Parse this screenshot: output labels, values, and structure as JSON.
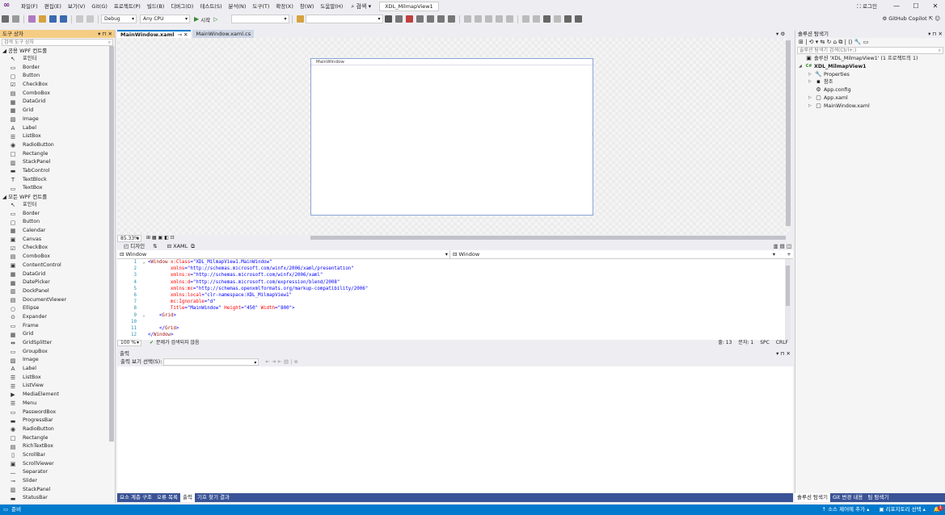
{
  "menu": {
    "items": [
      "파일(F)",
      "편집(E)",
      "보기(V)",
      "Git(G)",
      "프로젝트(P)",
      "빌드(B)",
      "디버그(D)",
      "테스트(S)",
      "분석(N)",
      "도구(T)",
      "확장(X)",
      "창(W)",
      "도움말(H)"
    ],
    "search_label": "검색",
    "project_title": "XDL_MilmapView1",
    "login": "로그인"
  },
  "toolbar": {
    "config": "Debug",
    "platform": "Any CPU",
    "start": "시작",
    "copilot": "GitHub Copilot"
  },
  "toolbox": {
    "title": "도구 상자",
    "search_placeholder": "검색 도구 상자",
    "group1": "공용 WPF 컨트롤",
    "common": [
      {
        "label": "포인터",
        "icon": "pointer-icon",
        "g": "↖"
      },
      {
        "label": "Border",
        "icon": "border-icon",
        "g": "▭"
      },
      {
        "label": "Button",
        "icon": "button-icon",
        "g": "▢"
      },
      {
        "label": "CheckBox",
        "icon": "checkbox-icon",
        "g": "☑"
      },
      {
        "label": "ComboBox",
        "icon": "combobox-icon",
        "g": "▤"
      },
      {
        "label": "DataGrid",
        "icon": "datagrid-icon",
        "g": "▦"
      },
      {
        "label": "Grid",
        "icon": "grid-icon",
        "g": "▦"
      },
      {
        "label": "Image",
        "icon": "image-icon",
        "g": "▨"
      },
      {
        "label": "Label",
        "icon": "label-icon",
        "g": "A"
      },
      {
        "label": "ListBox",
        "icon": "listbox-icon",
        "g": "☰"
      },
      {
        "label": "RadioButton",
        "icon": "radiobutton-icon",
        "g": "◉"
      },
      {
        "label": "Rectangle",
        "icon": "rectangle-icon",
        "g": "□"
      },
      {
        "label": "StackPanel",
        "icon": "stackpanel-icon",
        "g": "▥"
      },
      {
        "label": "TabControl",
        "icon": "tabcontrol-icon",
        "g": "▬"
      },
      {
        "label": "TextBlock",
        "icon": "textblock-icon",
        "g": "T"
      },
      {
        "label": "TextBox",
        "icon": "textbox-icon",
        "g": "▭"
      }
    ],
    "group2": "모든 WPF 컨트롤",
    "all": [
      {
        "label": "포인터",
        "icon": "pointer-icon",
        "g": "↖"
      },
      {
        "label": "Border",
        "icon": "border-icon",
        "g": "▭"
      },
      {
        "label": "Button",
        "icon": "button-icon",
        "g": "▢"
      },
      {
        "label": "Calendar",
        "icon": "calendar-icon",
        "g": "▦"
      },
      {
        "label": "Canvas",
        "icon": "canvas-icon",
        "g": "▣"
      },
      {
        "label": "CheckBox",
        "icon": "checkbox-icon",
        "g": "☑"
      },
      {
        "label": "ComboBox",
        "icon": "combobox-icon",
        "g": "▤"
      },
      {
        "label": "ContentControl",
        "icon": "contentcontrol-icon",
        "g": "▣"
      },
      {
        "label": "DataGrid",
        "icon": "datagrid-icon",
        "g": "▦"
      },
      {
        "label": "DatePicker",
        "icon": "datepicker-icon",
        "g": "▦"
      },
      {
        "label": "DockPanel",
        "icon": "dockpanel-icon",
        "g": "▥"
      },
      {
        "label": "DocumentViewer",
        "icon": "documentviewer-icon",
        "g": "▤"
      },
      {
        "label": "Ellipse",
        "icon": "ellipse-icon",
        "g": "○"
      },
      {
        "label": "Expander",
        "icon": "expander-icon",
        "g": "⊙"
      },
      {
        "label": "Frame",
        "icon": "frame-icon",
        "g": "▭"
      },
      {
        "label": "Grid",
        "icon": "grid-icon",
        "g": "▦"
      },
      {
        "label": "GridSplitter",
        "icon": "gridsplitter-icon",
        "g": "⇹"
      },
      {
        "label": "GroupBox",
        "icon": "groupbox-icon",
        "g": "▭"
      },
      {
        "label": "Image",
        "icon": "image-icon",
        "g": "▨"
      },
      {
        "label": "Label",
        "icon": "label-icon",
        "g": "A"
      },
      {
        "label": "ListBox",
        "icon": "listbox-icon",
        "g": "☰"
      },
      {
        "label": "ListView",
        "icon": "listview-icon",
        "g": "☰"
      },
      {
        "label": "MediaElement",
        "icon": "mediaelement-icon",
        "g": "▶"
      },
      {
        "label": "Menu",
        "icon": "menu-icon",
        "g": "☰"
      },
      {
        "label": "PasswordBox",
        "icon": "passwordbox-icon",
        "g": "▭"
      },
      {
        "label": "ProgressBar",
        "icon": "progressbar-icon",
        "g": "▬"
      },
      {
        "label": "RadioButton",
        "icon": "radiobutton-icon",
        "g": "◉"
      },
      {
        "label": "Rectangle",
        "icon": "rectangle-icon",
        "g": "□"
      },
      {
        "label": "RichTextBox",
        "icon": "richtextbox-icon",
        "g": "▤"
      },
      {
        "label": "ScrollBar",
        "icon": "scrollbar-icon",
        "g": "▯"
      },
      {
        "label": "ScrollViewer",
        "icon": "scrollviewer-icon",
        "g": "▣"
      },
      {
        "label": "Separator",
        "icon": "separator-icon",
        "g": "—"
      },
      {
        "label": "Slider",
        "icon": "slider-icon",
        "g": "⊸"
      },
      {
        "label": "StackPanel",
        "icon": "stackpanel-icon",
        "g": "▥"
      },
      {
        "label": "StatusBar",
        "icon": "statusbar-icon",
        "g": "▬"
      }
    ]
  },
  "editor": {
    "tabs": [
      {
        "label": "MainWindow.xaml",
        "selected": true
      },
      {
        "label": "MainWindow.xaml.cs",
        "selected": false
      }
    ],
    "designer_window_title": "MainWindow",
    "zoom": "85.33%",
    "design_tab": "디자인",
    "xaml_tab": "XAML",
    "left_selector": "Window",
    "right_selector": "Window",
    "code_lines": [
      {
        "n": "1",
        "fold": "⌄",
        "indent": "",
        "parts": [
          [
            "pun",
            "<"
          ],
          [
            "tag",
            "Window"
          ],
          [
            "attr",
            " x:Class"
          ],
          [
            "pun",
            "="
          ],
          [
            "val",
            "\"XDL_MilmapView1.MainWindow\""
          ]
        ]
      },
      {
        "n": "2",
        "fold": "",
        "indent": "        ",
        "parts": [
          [
            "attr",
            "xmlns"
          ],
          [
            "pun",
            "="
          ],
          [
            "val",
            "\"http://schemas.microsoft.com/winfx/2006/xaml/presentation\""
          ]
        ]
      },
      {
        "n": "3",
        "fold": "",
        "indent": "        ",
        "parts": [
          [
            "attr",
            "xmlns:x"
          ],
          [
            "pun",
            "="
          ],
          [
            "val",
            "\"http://schemas.microsoft.com/winfx/2006/xaml\""
          ]
        ]
      },
      {
        "n": "4",
        "fold": "",
        "indent": "        ",
        "parts": [
          [
            "attr",
            "xmlns:d"
          ],
          [
            "pun",
            "="
          ],
          [
            "val",
            "\"http://schemas.microsoft.com/expression/blend/2008\""
          ]
        ]
      },
      {
        "n": "5",
        "fold": "",
        "indent": "        ",
        "parts": [
          [
            "attr",
            "xmlns:mc"
          ],
          [
            "pun",
            "="
          ],
          [
            "val",
            "\"http://schemas.openxmlformats.org/markup-compatibility/2006\""
          ]
        ]
      },
      {
        "n": "6",
        "fold": "",
        "indent": "        ",
        "parts": [
          [
            "attr",
            "xmlns:local"
          ],
          [
            "pun",
            "="
          ],
          [
            "val",
            "\"clr-namespace:XDL_MilmapView1\""
          ]
        ]
      },
      {
        "n": "7",
        "fold": "",
        "indent": "        ",
        "parts": [
          [
            "attr",
            "mc:Ignorable"
          ],
          [
            "pun",
            "="
          ],
          [
            "val",
            "\"d\""
          ]
        ]
      },
      {
        "n": "8",
        "fold": "",
        "indent": "        ",
        "parts": [
          [
            "attr",
            "Title"
          ],
          [
            "pun",
            "="
          ],
          [
            "val",
            "\"MainWindow\""
          ],
          [
            "attr",
            " Height"
          ],
          [
            "pun",
            "="
          ],
          [
            "val",
            "\"450\""
          ],
          [
            "attr",
            " Width"
          ],
          [
            "pun",
            "="
          ],
          [
            "val",
            "\"800\""
          ],
          [
            "pun",
            ">"
          ]
        ]
      },
      {
        "n": "9",
        "fold": "⌄",
        "indent": "    ",
        "parts": [
          [
            "pun",
            "<"
          ],
          [
            "tag",
            "Grid"
          ],
          [
            "pun",
            ">"
          ]
        ]
      },
      {
        "n": "10",
        "fold": "",
        "indent": "",
        "parts": []
      },
      {
        "n": "11",
        "fold": "",
        "indent": "    ",
        "parts": [
          [
            "pun",
            "</"
          ],
          [
            "tag",
            "Grid"
          ],
          [
            "pun",
            ">"
          ]
        ]
      },
      {
        "n": "12",
        "fold": "",
        "indent": "",
        "parts": [
          [
            "pun",
            "</"
          ],
          [
            "tag",
            "Window"
          ],
          [
            "pun",
            ">"
          ]
        ]
      }
    ],
    "status_zoom": "100 %",
    "status_msg": "문제가 검색되지 않음",
    "status_line": "줄: 13",
    "status_col": "문자: 1",
    "status_spc": "SPC",
    "status_crlf": "CRLF"
  },
  "output": {
    "title": "출력",
    "source_label": "출력 보기 선택(S):",
    "source_value": "",
    "bottom_tabs": [
      "요소 계층 구조",
      "오류 목록",
      "출력",
      "기호 찾기 결과"
    ],
    "bottom_tab_selected": 2
  },
  "solution": {
    "title": "솔루션 탐색기",
    "search_placeholder": "솔루션 탐색기 검색(Ctrl+;)",
    "nodes": [
      {
        "label": "솔루션 'XDL_MilmapView1' (1 프로젝트의 1)",
        "depth": 0,
        "arrow": "",
        "icon": "solution-icon",
        "g": "▣",
        "bold": false
      },
      {
        "label": "XDL_MilmapView1",
        "depth": 0,
        "arrow": "◢",
        "icon": "csharp-project-icon",
        "g": "C#",
        "bold": true
      },
      {
        "label": "Properties",
        "depth": 1,
        "arrow": "▷",
        "icon": "wrench-icon",
        "g": "🔧",
        "bold": false
      },
      {
        "label": "참조",
        "depth": 1,
        "arrow": "▷",
        "icon": "references-icon",
        "g": "▪",
        "bold": false
      },
      {
        "label": "App.config",
        "depth": 1,
        "arrow": "",
        "icon": "config-file-icon",
        "g": "⚙",
        "bold": false
      },
      {
        "label": "App.xaml",
        "depth": 1,
        "arrow": "▷",
        "icon": "xaml-file-icon",
        "g": "▢",
        "bold": false
      },
      {
        "label": "MainWindow.xaml",
        "depth": 1,
        "arrow": "▷",
        "icon": "xaml-file-icon",
        "g": "▢",
        "bold": false
      }
    ],
    "bottom_tabs": [
      "솔루션 탐색기",
      "Git 변경 내용",
      "팀 탐색기"
    ],
    "bottom_tab_selected": 0
  },
  "status": {
    "ready": "준비",
    "source_control": "소스 제어에 추가",
    "repo": "리포지토리 선택",
    "notif": "1"
  },
  "colors": {
    "accent": "#007acc",
    "toolbox_header": "#f5cc84",
    "tab_strip": "#3a5396"
  }
}
